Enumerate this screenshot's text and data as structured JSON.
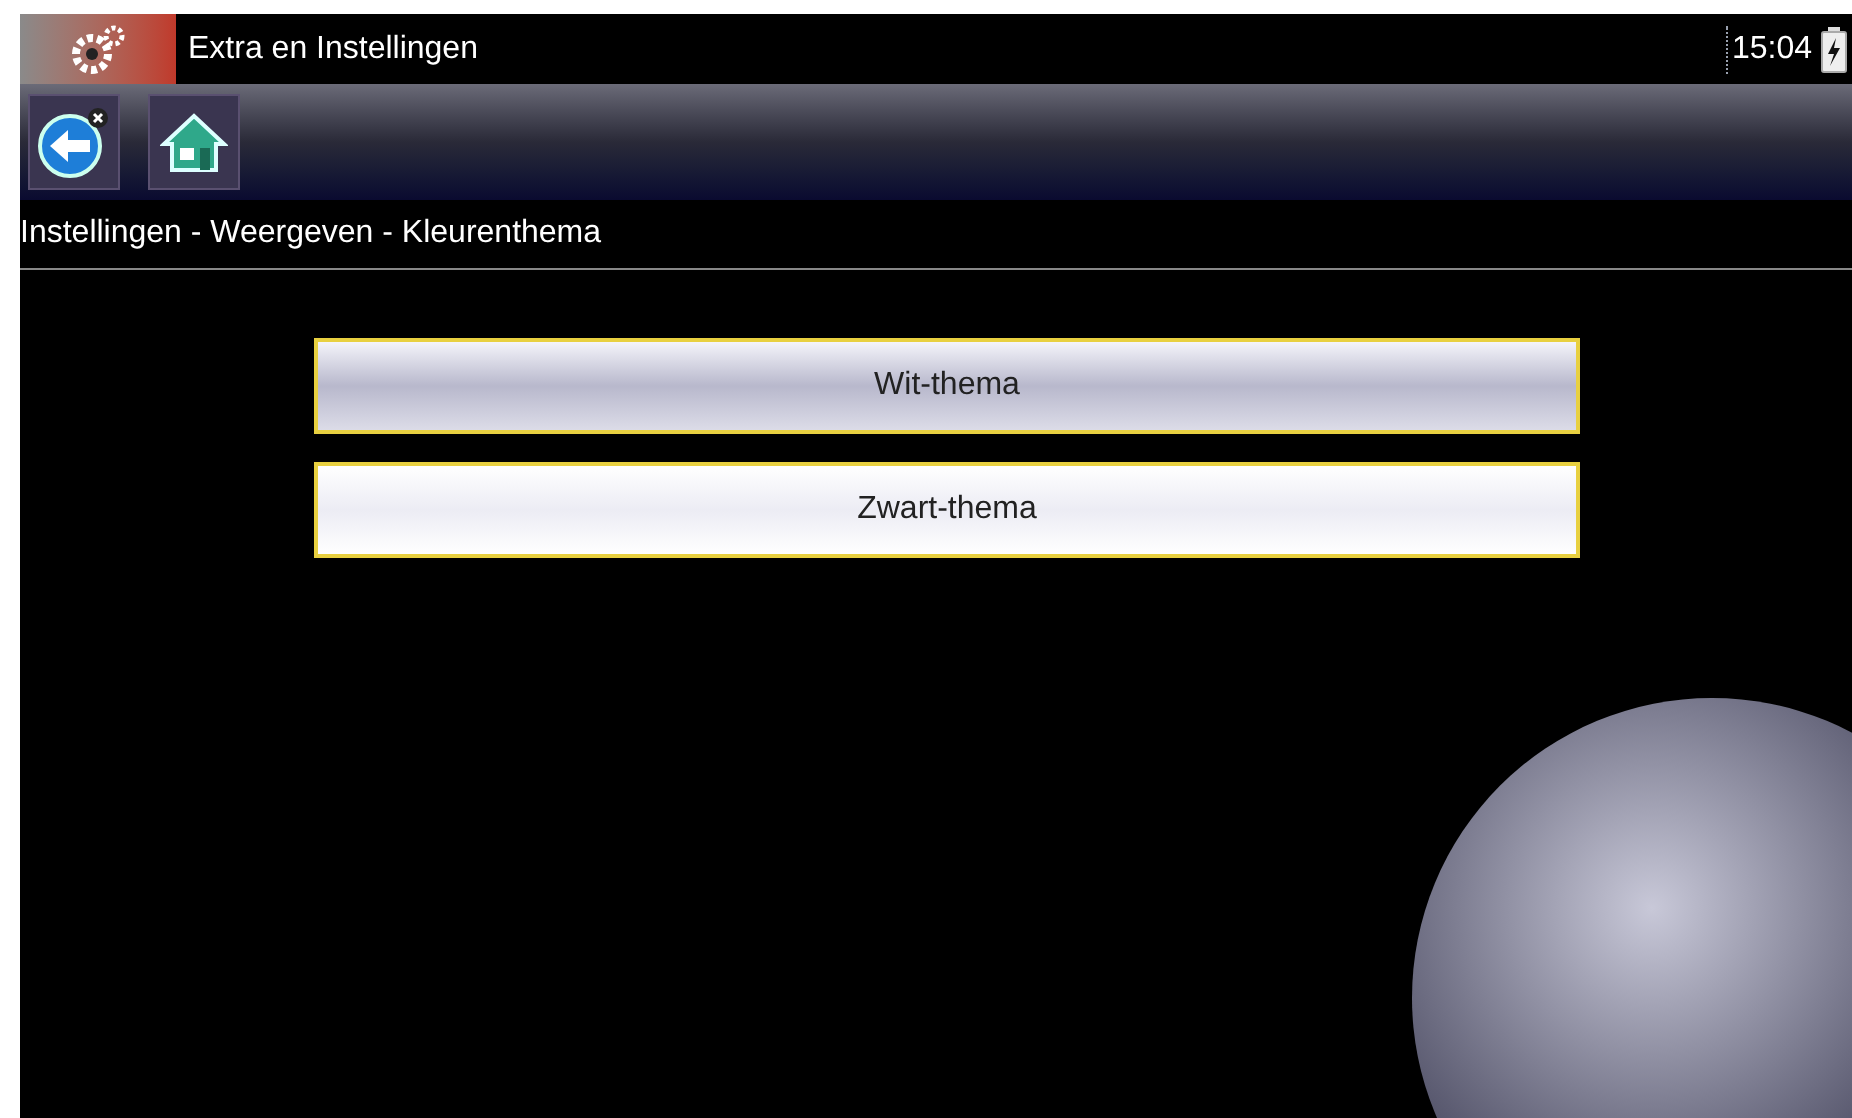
{
  "title_bar": {
    "title": "Extra en Instellingen",
    "time": "15:04"
  },
  "breadcrumb": "Instellingen - Weergeven - Kleurenthema",
  "options": [
    {
      "label": "Wit-thema",
      "selected": true
    },
    {
      "label": "Zwart-thema",
      "selected": false
    }
  ]
}
